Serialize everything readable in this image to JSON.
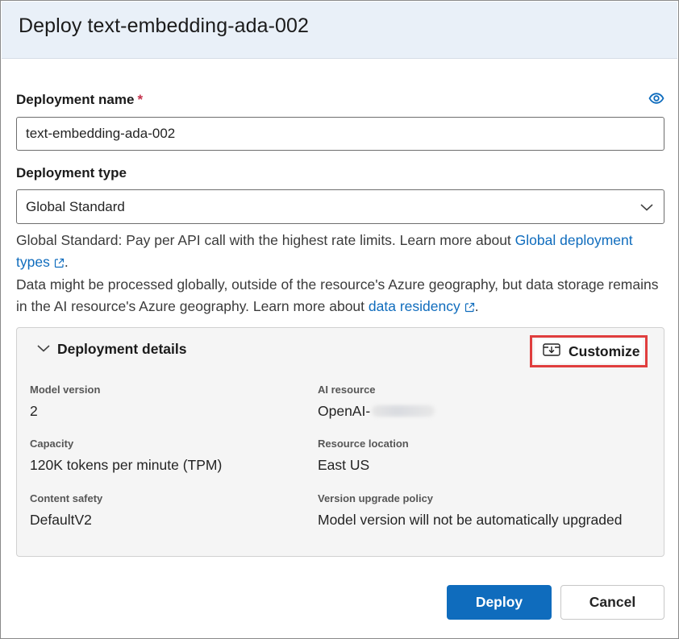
{
  "dialog": {
    "title": "Deploy text-embedding-ada-002"
  },
  "deployment_name": {
    "label": "Deployment name",
    "required_marker": "*",
    "value": "text-embedding-ada-002",
    "visibility_icon": "eye-icon"
  },
  "deployment_type": {
    "label": "Deployment type",
    "selected": "Global Standard",
    "icon": "chevron-down-icon"
  },
  "info": {
    "line1_text": "Global Standard: Pay per API call with the highest rate limits. Learn more about ",
    "line1_link": "Global deployment types",
    "line1_end": ".",
    "line2_text": "Data might be processed globally, outside of the resource's Azure geography, but data storage remains in the AI resource's Azure geography. Learn more about ",
    "line2_link": "data residency",
    "line2_end": "."
  },
  "details": {
    "title": "Deployment details",
    "customize_label": "Customize",
    "fields": {
      "model_version": {
        "label": "Model version",
        "value": "2"
      },
      "ai_resource": {
        "label": "AI resource",
        "value": "OpenAI-"
      },
      "capacity": {
        "label": "Capacity",
        "value": "120K tokens per minute (TPM)"
      },
      "resource_location": {
        "label": "Resource location",
        "value": "East US"
      },
      "content_safety": {
        "label": "Content safety",
        "value": "DefaultV2"
      },
      "version_upgrade_policy": {
        "label": "Version upgrade policy",
        "value": "Model version will not be automatically upgraded"
      }
    }
  },
  "footer": {
    "deploy_label": "Deploy",
    "cancel_label": "Cancel"
  },
  "colors": {
    "accent": "#0f6cbd",
    "header_bg": "#e9f0f8",
    "highlight_border": "#e03e3e",
    "required": "#c4314b"
  }
}
